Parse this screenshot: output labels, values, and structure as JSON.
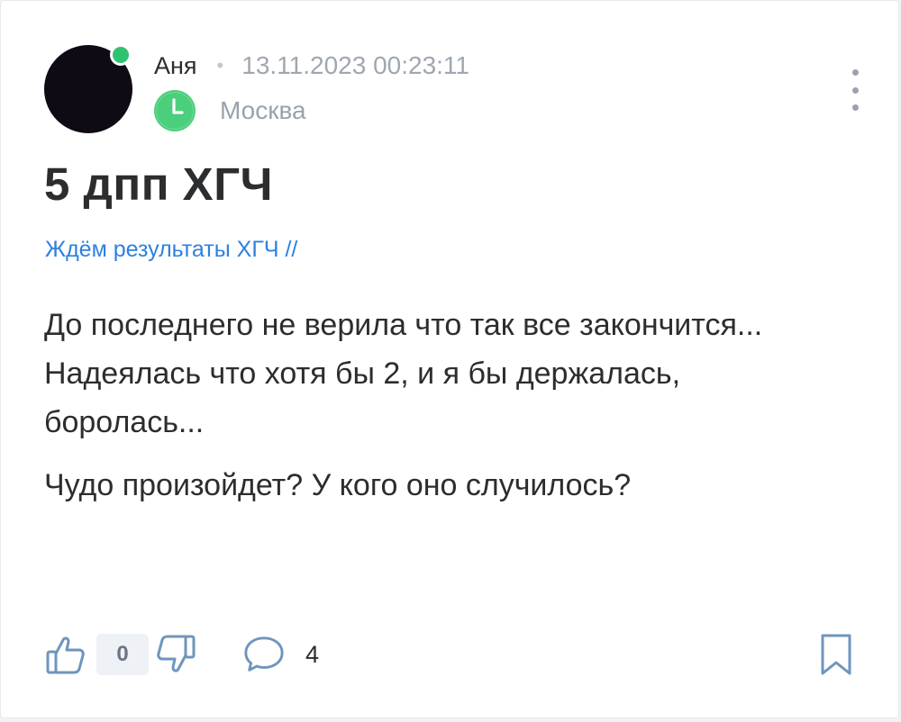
{
  "post": {
    "author": "Аня",
    "separator": "•",
    "datetime": "13.11.2023 00:23:11",
    "location": "Москва",
    "title": "5 дпп ХГЧ",
    "topic": "Ждём результаты ХГЧ //",
    "body": [
      "До последнего не верила что так все закончится... Надеялась что хотя бы 2, и я бы держалась, боролась...",
      "Чудо произойдет? У кого оно случилось?"
    ]
  },
  "actions": {
    "score": "0",
    "comments": "4"
  },
  "colors": {
    "accent_link": "#2d81e0",
    "online": "#2fc270",
    "clock_icon": "#4ccf7d",
    "icon_gray": "#6f95bd"
  },
  "icons": {
    "like": "thumb-up-icon",
    "dislike": "thumb-down-icon",
    "comment": "speech-bubble-icon",
    "bookmark": "bookmark-icon",
    "menu": "more-vertical-icon",
    "location": "clock-icon"
  }
}
